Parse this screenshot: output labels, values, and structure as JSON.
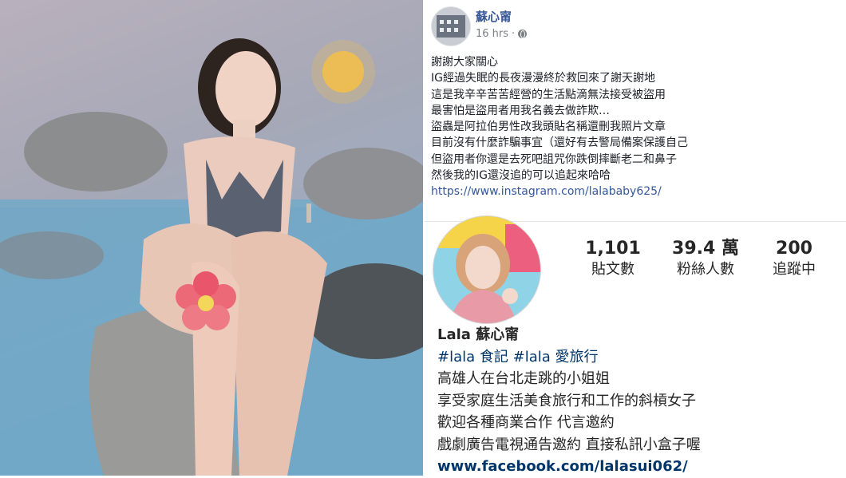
{
  "facebook_post": {
    "author": "蘇心甯",
    "timestamp": "16 hrs",
    "lines": [
      "謝謝大家關心",
      "IG經過失眠的長夜漫漫終於救回來了謝天謝地",
      "這是我辛辛苦苦經營的生活點滴無法接受被盜用",
      "最害怕是盜用者用我名義去做詐欺…",
      "盜蟲是阿拉伯男性改我頭貼名稱還刪我照片文章",
      "目前沒有什麼詐騙事宜（還好有去警局備案保護自己",
      "但盜用者你還是去死吧詛咒你跌倒摔斷老二和鼻子",
      "然後我的IG還沒追的可以追起來哈哈"
    ],
    "link": "https://www.instagram.com/lalababy625/"
  },
  "instagram_profile": {
    "stats": [
      {
        "value": "1,101",
        "label": "貼文數"
      },
      {
        "value": "39.4 萬",
        "label": "粉絲人數"
      },
      {
        "value": "200",
        "label": "追蹤中"
      }
    ],
    "name": "Lala 蘇心甯",
    "hashtags": [
      "#lala 食記",
      "#lala 愛旅行"
    ],
    "bio_lines": [
      "高雄人在台北走跳的小姐姐",
      "享受家庭生活美食旅行和工作的斜槓女子",
      "歡迎各種商業合作 代言邀約",
      "戲劇廣告電視通告邀約 直接私訊小盒子喔"
    ],
    "website": "www.facebook.com/lalasui062/"
  },
  "icons": {
    "privacy": "globe-icon"
  },
  "colors": {
    "fb_name": "#385898",
    "fb_link": "#365899",
    "ig_link": "#003569"
  }
}
